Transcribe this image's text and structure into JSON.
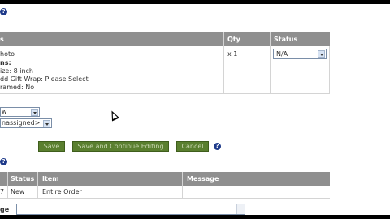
{
  "top_help_icon": "?",
  "items_table": {
    "headers": {
      "item": "s",
      "qty": "Qty",
      "status": "Status"
    },
    "row": {
      "name": "hoto",
      "options_label": "ns:",
      "option_lines": [
        "ize: 8 inch",
        "dd Gift Wrap: Please Select",
        "ramed: No"
      ],
      "qty": "x 1",
      "status_value": "N/A"
    }
  },
  "dropdown_one": "w",
  "dropdown_two": "nassigned>",
  "buttons": {
    "save": "Save",
    "save_continue": "Save and Continue Editing",
    "cancel": "Cancel",
    "help_icon": "?"
  },
  "messages_help_icon": "?",
  "messages_table": {
    "headers": {
      "status": "Status",
      "item": "Item",
      "message": "Message"
    },
    "rows": [
      {
        "id": "7",
        "status": "New",
        "item": "Entire Order",
        "message": ""
      }
    ]
  },
  "message_label": "ge",
  "colors": {
    "header_bg": "#8f8f8f",
    "button_bg": "#5a7f2f",
    "help_icon": "#1e3a8a"
  }
}
